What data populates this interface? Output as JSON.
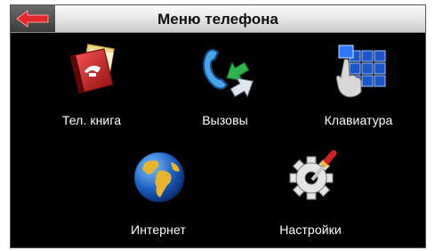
{
  "header": {
    "title": "Меню телефона"
  },
  "menu": [
    {
      "id": "phonebook",
      "label": "Тел. книга",
      "icon": "phonebook-icon"
    },
    {
      "id": "calls",
      "label": "Вызовы",
      "icon": "calls-icon"
    },
    {
      "id": "keypad",
      "label": "Клавиатура",
      "icon": "keypad-icon"
    },
    {
      "id": "internet",
      "label": "Интернет",
      "icon": "globe-icon"
    },
    {
      "id": "settings",
      "label": "Настройки",
      "icon": "settings-gear-icon"
    }
  ],
  "colors": {
    "background": "#000000",
    "header": "#e6e6e6",
    "back_arrow": "#e5262b",
    "label_text": "#ffffff"
  }
}
